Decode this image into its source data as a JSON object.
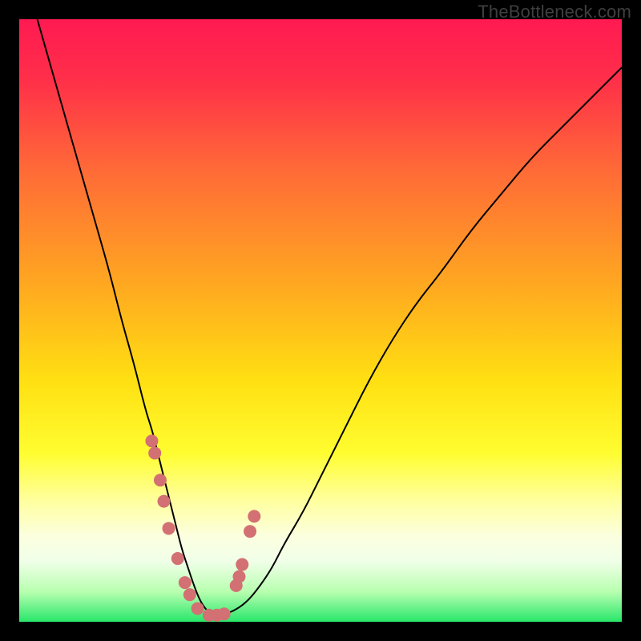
{
  "watermark": "TheBottleneck.com",
  "chart_data": {
    "type": "line",
    "title": "",
    "xlabel": "",
    "ylabel": "",
    "xlim": [
      0,
      100
    ],
    "ylim": [
      0,
      100
    ],
    "grid": false,
    "legend": false,
    "background_gradient": {
      "stops": [
        {
          "offset": 0.0,
          "color": "#ff1a52"
        },
        {
          "offset": 0.1,
          "color": "#ff2f49"
        },
        {
          "offset": 0.25,
          "color": "#ff6a37"
        },
        {
          "offset": 0.45,
          "color": "#ffab1f"
        },
        {
          "offset": 0.6,
          "color": "#ffe012"
        },
        {
          "offset": 0.72,
          "color": "#fffd30"
        },
        {
          "offset": 0.8,
          "color": "#ffffa0"
        },
        {
          "offset": 0.86,
          "color": "#fbffe0"
        },
        {
          "offset": 0.9,
          "color": "#f0ffe8"
        },
        {
          "offset": 0.95,
          "color": "#b8ffb0"
        },
        {
          "offset": 1.0,
          "color": "#28e66a"
        }
      ]
    },
    "series": [
      {
        "name": "curve",
        "color": "#000000",
        "stroke_width": 2,
        "x": [
          3,
          5,
          7,
          9,
          11,
          13,
          15,
          17,
          19,
          21,
          22,
          23,
          24,
          25,
          26,
          27,
          28,
          29,
          30,
          31,
          32,
          33,
          34,
          36,
          38,
          40,
          42,
          44,
          47,
          50,
          54,
          58,
          62,
          66,
          70,
          75,
          80,
          85,
          90,
          95,
          100
        ],
        "y": [
          100,
          93,
          86,
          79,
          72,
          65,
          58,
          50,
          43,
          35,
          32,
          28,
          24,
          20,
          16,
          12,
          9,
          6,
          3.5,
          2,
          1.2,
          1,
          1.2,
          2,
          3.5,
          6,
          9,
          13,
          18,
          24,
          32,
          40,
          47,
          53,
          58,
          65,
          71,
          77,
          82,
          87,
          92
        ]
      },
      {
        "name": "markers",
        "type": "scatter",
        "color": "#d37073",
        "marker_radius": 8,
        "x": [
          22.0,
          22.5,
          23.4,
          24.0,
          24.8,
          26.3,
          27.5,
          28.3,
          29.6,
          31.5,
          32.8,
          34.0,
          36.0,
          36.5,
          37.0,
          38.3,
          39.0
        ],
        "y": [
          30.0,
          28.0,
          23.5,
          20.0,
          15.5,
          10.5,
          6.5,
          4.5,
          2.2,
          1.1,
          1.1,
          1.3,
          6.0,
          7.5,
          9.5,
          15.0,
          17.5
        ]
      }
    ]
  }
}
